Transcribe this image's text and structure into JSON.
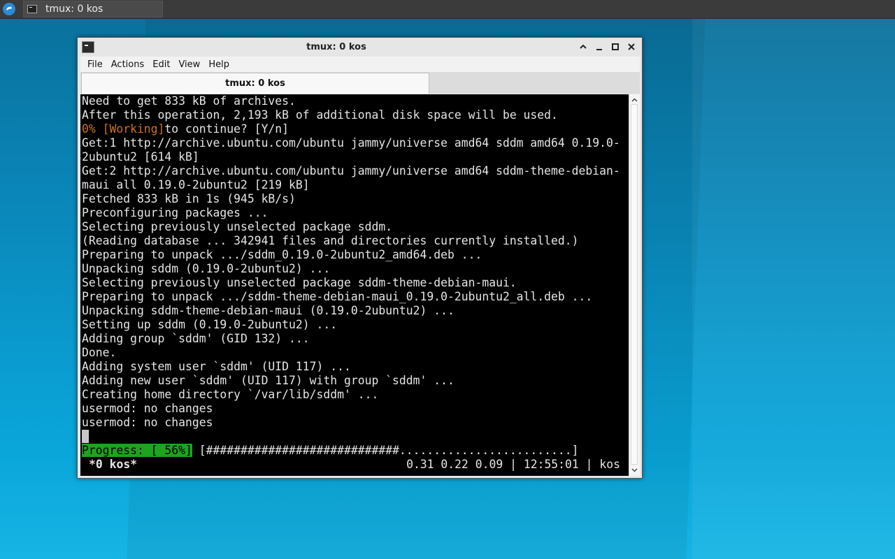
{
  "taskbar": {
    "task_title": "tmux: 0 kos",
    "menu_icon": "app-menu-icon",
    "task_icon": "terminal-icon"
  },
  "window": {
    "title": "tmux: 0 kos",
    "icon": "terminal-icon",
    "buttons": [
      "shade-up-icon",
      "minimize-icon",
      "maximize-icon",
      "close-icon"
    ]
  },
  "menubar": {
    "file": "File",
    "actions": "Actions",
    "edit": "Edit",
    "view": "View",
    "help": "Help"
  },
  "tabs": [
    {
      "label": "tmux: 0 kos",
      "active": true
    }
  ],
  "terminal": {
    "lines": [
      "Need to get 833 kB of archives.",
      "After this operation, 2,193 kB of additional disk space will be used.",
      "__working__",
      "Get:1 http://archive.ubuntu.com/ubuntu jammy/universe amd64 sddm amd64 0.19.0-",
      "2ubuntu2 [614 kB]",
      "Get:2 http://archive.ubuntu.com/ubuntu jammy/universe amd64 sddm-theme-debian-",
      "maui all 0.19.0-2ubuntu2 [219 kB]",
      "Fetched 833 kB in 1s (945 kB/s)",
      "Preconfiguring packages ...",
      "Selecting previously unselected package sddm.",
      "(Reading database ... 342941 files and directories currently installed.)",
      "Preparing to unpack .../sddm_0.19.0-2ubuntu2_amd64.deb ...",
      "Unpacking sddm (0.19.0-2ubuntu2) ...",
      "Selecting previously unselected package sddm-theme-debian-maui.",
      "Preparing to unpack .../sddm-theme-debian-maui_0.19.0-2ubuntu2_all.deb ...",
      "Unpacking sddm-theme-debian-maui (0.19.0-2ubuntu2) ...",
      "Setting up sddm (0.19.0-2ubuntu2) ...",
      "Adding group `sddm' (GID 132) ...",
      "Done.",
      "Adding system user `sddm' (UID 117) ...",
      "Adding new user `sddm' (UID 117) with group `sddm' ...",
      "Creating home directory `/var/lib/sddm' ...",
      "usermod: no changes",
      "usermod: no changes"
    ],
    "working_prefix": "0% [Working]",
    "working_suffix": "to continue? [Y/n]",
    "progress_label": "Progress: [ 56%]",
    "progress_bar": " [############################.........................]",
    "progress_percent": 56,
    "status_left": "*0 kos*",
    "status_right": "0.31 0.22 0.09 | 12:55:01 | kos"
  },
  "colors": {
    "progress_bg": "#1ea31e",
    "working_text": "#d0701a",
    "terminal_bg": "#000000",
    "terminal_fg": "#e5e5e5"
  }
}
